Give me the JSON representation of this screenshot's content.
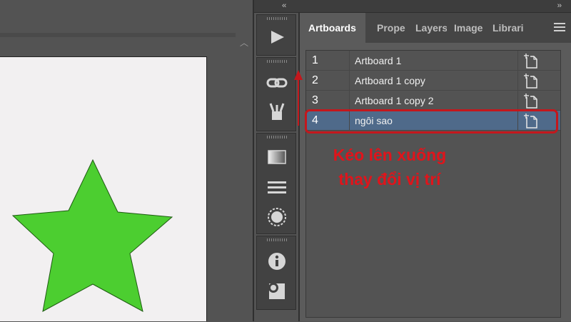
{
  "panel": {
    "tabs": [
      {
        "label": "Artboards",
        "active": true
      },
      {
        "label": "Prope",
        "active": false
      },
      {
        "label": "Layers",
        "active": false
      },
      {
        "label": "Image",
        "active": false
      },
      {
        "label": "Librari",
        "active": false
      }
    ],
    "menu_icon": "hamburger-menu-icon"
  },
  "artboards": [
    {
      "number": "1",
      "name": "Artboard 1",
      "selected": false
    },
    {
      "number": "2",
      "name": "Artboard 1 copy",
      "selected": false
    },
    {
      "number": "3",
      "name": "Artboard 1 copy 2",
      "selected": false
    },
    {
      "number": "4",
      "name": "ngôi sao",
      "selected": true
    }
  ],
  "annotation": {
    "line1": "Kéo lên xuống",
    "line2": "thay đổi vị trí",
    "color": "#e0141b"
  },
  "toolbar": {
    "tools": [
      "play-icon",
      "link-icon",
      "brush-icon",
      "gradient-icon",
      "lines-icon",
      "circle-dotted-icon",
      "info-icon",
      "shape-icon"
    ]
  },
  "collapse": {
    "left": "‹‹",
    "right": "››"
  },
  "canvas": {
    "shape_color": "#4cce30",
    "artboard_color": "#f2f0f1"
  }
}
